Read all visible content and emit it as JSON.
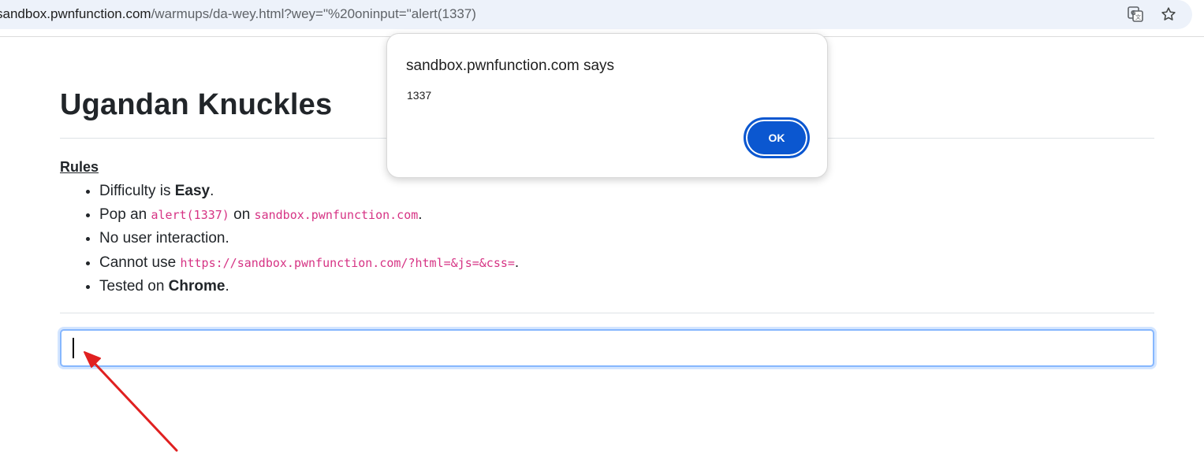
{
  "browser": {
    "url_domain": "sandbox.pwnfunction.com",
    "url_path": "/warmups/da-wey.html?wey=\"%20oninput=\"alert(1337)",
    "icons": [
      "translate-icon",
      "bookmark-star-icon"
    ]
  },
  "page": {
    "title": "Ugandan Knuckles",
    "rules_heading": "Rules",
    "rules": [
      {
        "pre": "Difficulty is ",
        "bold": "Easy",
        "post": "."
      },
      {
        "pre": "Pop an ",
        "code1": "alert(1337)",
        "mid": " on ",
        "code2": "sandbox.pwnfunction.com",
        "post": "."
      },
      {
        "pre": "No user interaction."
      },
      {
        "pre": "Cannot use ",
        "code1": "https://sandbox.pwnfunction.com/?html=&js=&css=",
        "post": "."
      },
      {
        "pre": "Tested on ",
        "bold": "Chrome",
        "post": "."
      }
    ],
    "input_value": ""
  },
  "dialog": {
    "title": "sandbox.pwnfunction.com says",
    "message": "1337",
    "ok_label": "OK"
  },
  "colors": {
    "accent": "#0b57d0",
    "code": "#d63384",
    "arrow": "#e02020"
  }
}
